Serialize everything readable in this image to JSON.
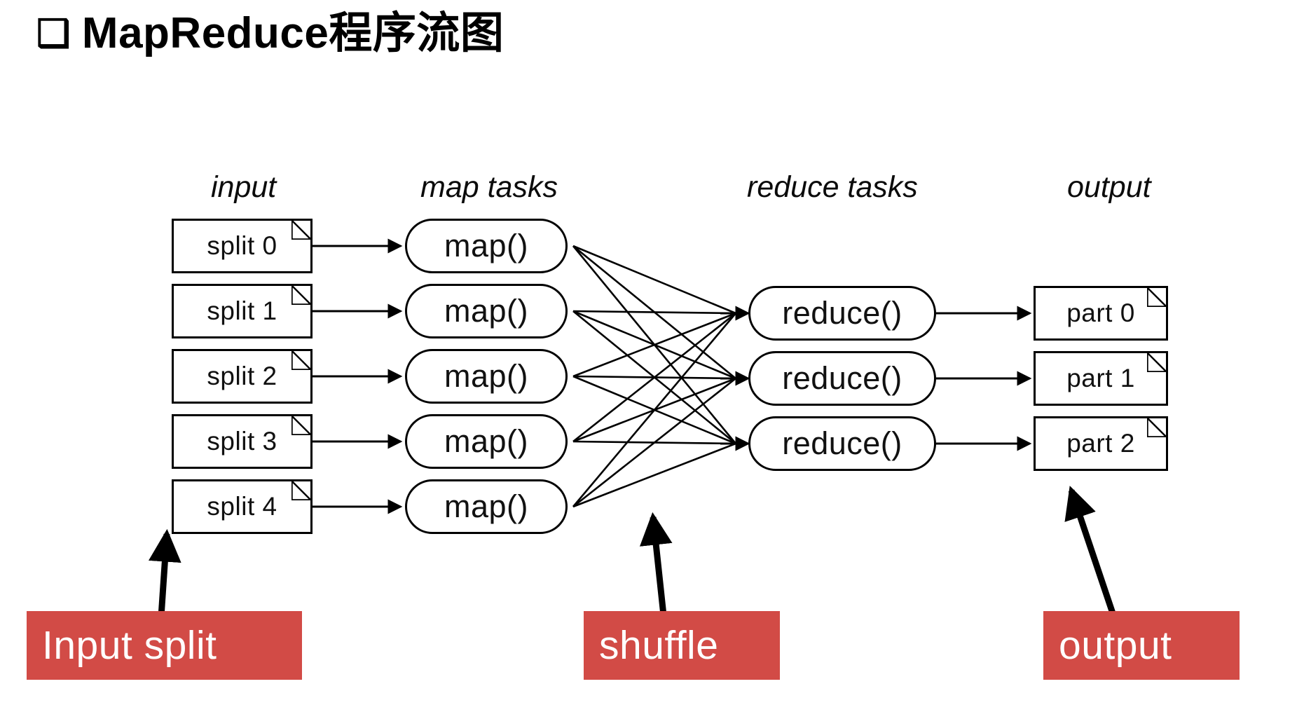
{
  "slide": {
    "bullet_glyph": "❑",
    "title": "MapReduce程序流图"
  },
  "diagram": {
    "columns": [
      {
        "key": "input",
        "label": "input"
      },
      {
        "key": "map_tasks",
        "label": "map tasks"
      },
      {
        "key": "reduce_tasks",
        "label": "reduce tasks"
      },
      {
        "key": "output",
        "label": "output"
      }
    ],
    "input_splits": [
      {
        "label": "split 0"
      },
      {
        "label": "split 1"
      },
      {
        "label": "split 2"
      },
      {
        "label": "split 3"
      },
      {
        "label": "split 4"
      }
    ],
    "map_tasks": [
      {
        "label": "map()"
      },
      {
        "label": "map()"
      },
      {
        "label": "map()"
      },
      {
        "label": "map()"
      },
      {
        "label": "map()"
      }
    ],
    "reduce_tasks": [
      {
        "label": "reduce()"
      },
      {
        "label": "reduce()"
      },
      {
        "label": "reduce()"
      }
    ],
    "outputs": [
      {
        "label": "part 0"
      },
      {
        "label": "part 1"
      },
      {
        "label": "part 2"
      }
    ]
  },
  "callouts": [
    {
      "key": "input-split",
      "label": "Input split",
      "color": "#D24B46"
    },
    {
      "key": "shuffle",
      "label": "shuffle",
      "color": "#D24B46"
    },
    {
      "key": "output",
      "label": "output",
      "color": "#D24B46"
    }
  ],
  "colors": {
    "callout_red": "#D24B46",
    "callout_text": "#FFFFFF",
    "stroke": "#000000",
    "background": "#FFFFFF"
  }
}
